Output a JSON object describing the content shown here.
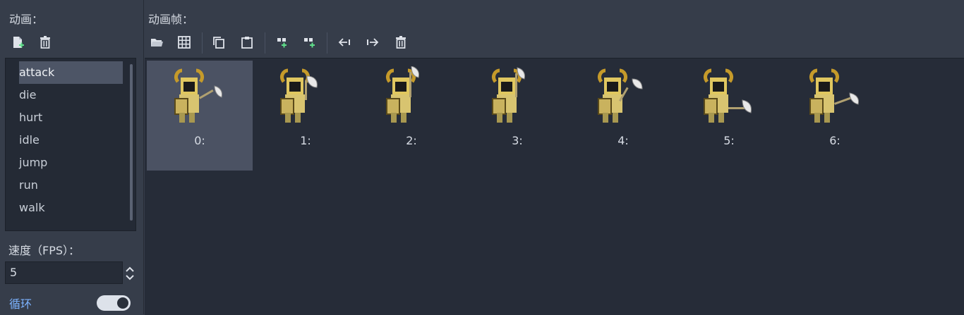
{
  "left": {
    "animations_label": "动画：",
    "animations": [
      "attack",
      "die",
      "hurt",
      "idle",
      "jump",
      "run",
      "walk"
    ],
    "selected_animation": "attack",
    "speed_label": "速度（FPS）：",
    "speed_value": "5",
    "loop_label": "循环",
    "loop_enabled": true
  },
  "right": {
    "frames_label": "动画帧：",
    "frames": [
      {
        "label": "0:"
      },
      {
        "label": "1:"
      },
      {
        "label": "2:"
      },
      {
        "label": "3:"
      },
      {
        "label": "4:"
      },
      {
        "label": "5:"
      },
      {
        "label": "6:"
      }
    ],
    "selected_frame": 0
  },
  "icons": {
    "left_toolbar": [
      "new-animation-icon",
      "delete-animation-icon"
    ],
    "right_toolbar": [
      "load-frames-icon",
      "sprite-sheet-icon",
      "copy-icon",
      "paste-icon",
      "insert-before-icon",
      "insert-after-icon",
      "move-left-icon",
      "move-right-icon",
      "delete-frame-icon"
    ]
  },
  "colors": {
    "panel_bg": "#363d4a",
    "list_bg": "#242a35",
    "selection": "#4d5566",
    "accent": "#7cb3ff"
  }
}
